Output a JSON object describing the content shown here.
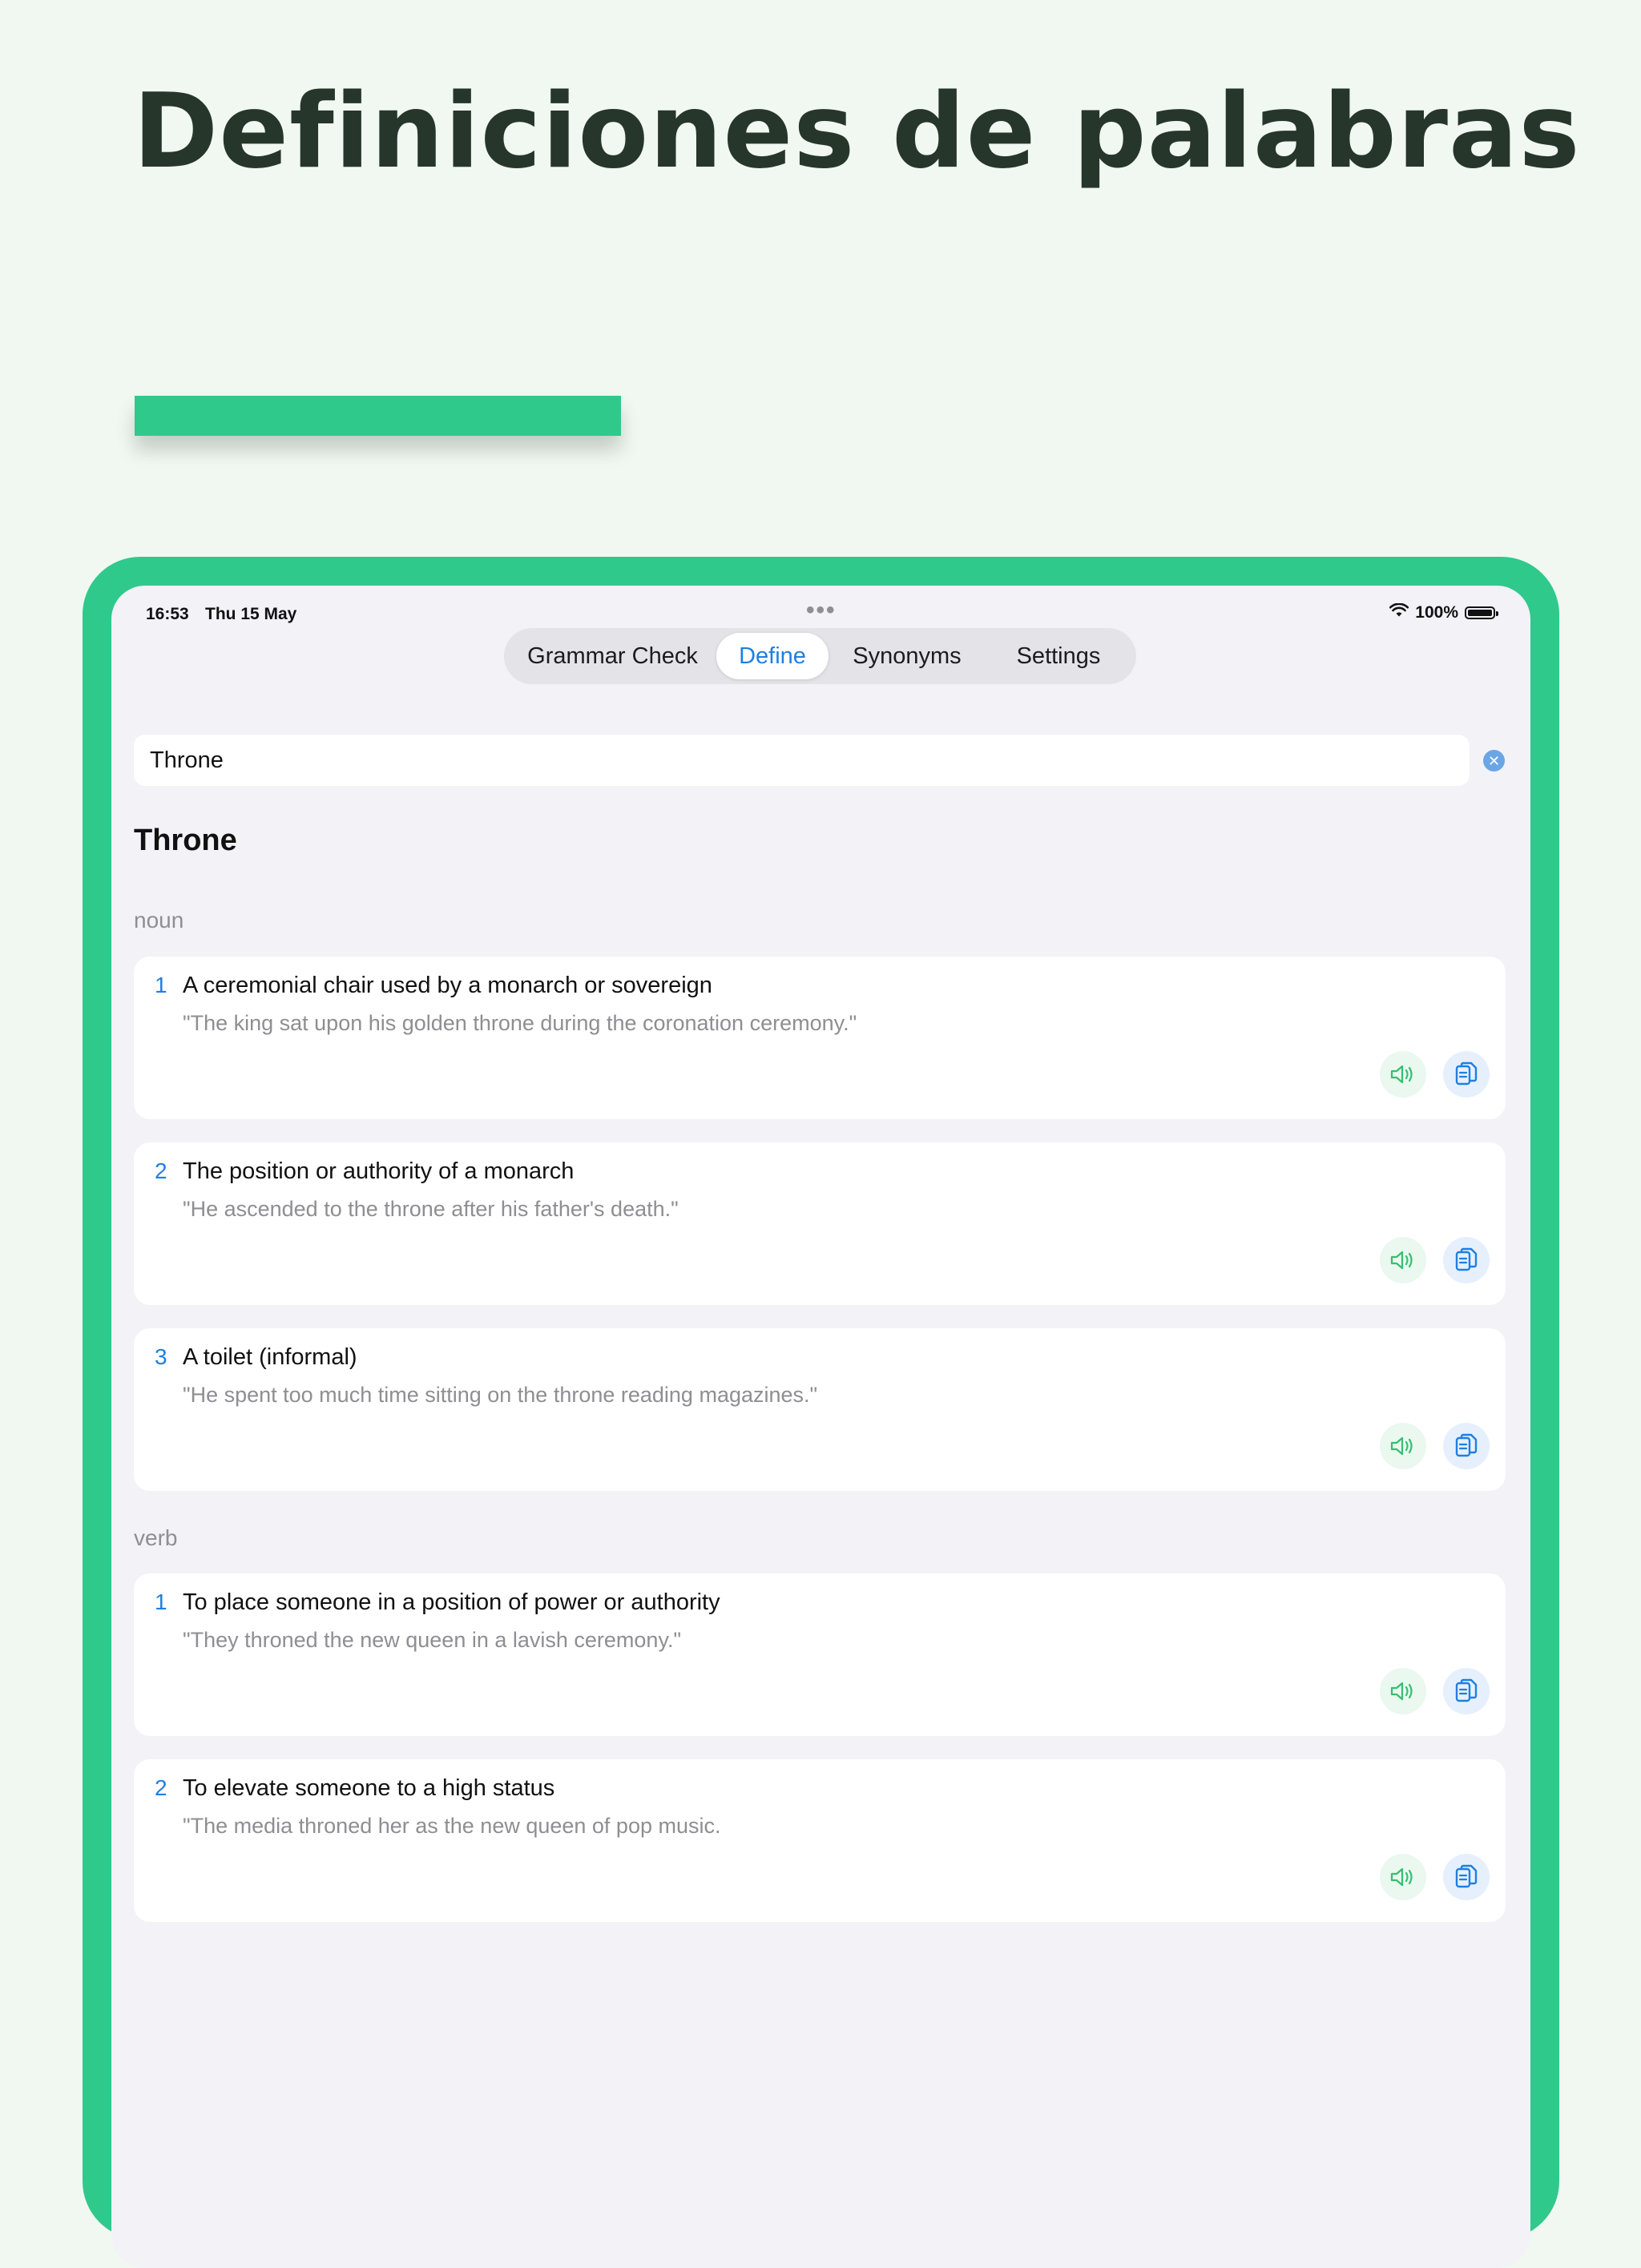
{
  "headline": "Definiciones de palabras",
  "status": {
    "time": "16:53",
    "date": "Thu 15 May",
    "battery": "100%",
    "battery_level": 1.0
  },
  "tabs": {
    "grammar": "Grammar Check",
    "define": "Define",
    "synonyms": "Synonyms",
    "settings": "Settings",
    "active": "Define"
  },
  "search": {
    "value": "Throne"
  },
  "result": {
    "word": "Throne",
    "noun": {
      "label": "noun",
      "defs": [
        {
          "num": "1",
          "text": "A ceremonial chair used by a monarch or sovereign",
          "example": "\"The king sat upon his golden throne during the coronation ceremony.\""
        },
        {
          "num": "2",
          "text": "The position or authority of a monarch",
          "example": "\"He ascended to the throne after his father's death.\""
        },
        {
          "num": "3",
          "text": "A toilet (informal)",
          "example": "\"He spent too much time sitting on the throne reading magazines.\""
        }
      ]
    },
    "verb": {
      "label": "verb",
      "defs": [
        {
          "num": "1",
          "text": "To place someone in a position of power or authority",
          "example": "\"They throned the new queen in a lavish ceremony.\""
        },
        {
          "num": "2",
          "text": "To elevate someone to a high status",
          "example": "\"The media throned her as the new queen of pop music."
        }
      ]
    }
  },
  "colors": {
    "accent_green": "#2fc98c",
    "link_blue": "#1f7fe0",
    "headline": "#27362b"
  },
  "icons": {
    "speak": "speaker-icon",
    "copy": "copy-icon",
    "clear": "clear-icon",
    "wifi": "wifi-icon",
    "battery": "battery-icon"
  }
}
